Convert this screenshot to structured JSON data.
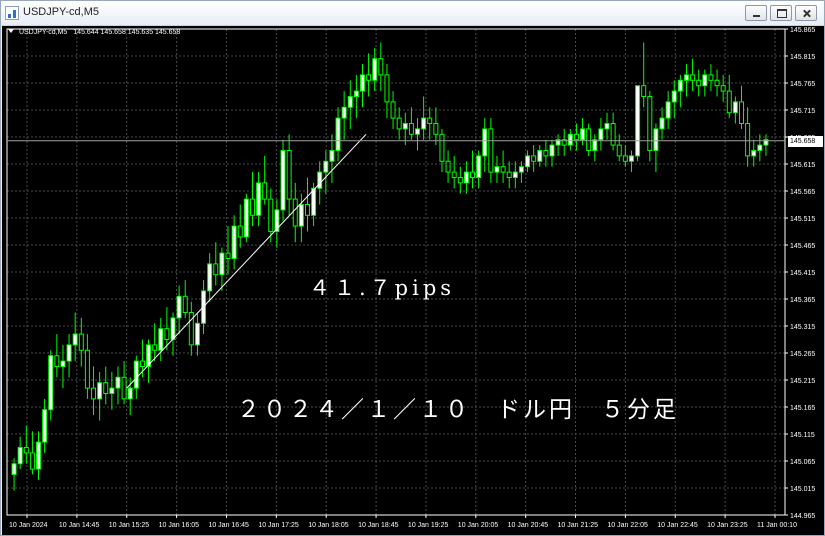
{
  "window": {
    "title": "USDJPY-cd,M5"
  },
  "header": {
    "symbol": "USDJPY-cd,M5",
    "ohlc": "145.644 145.658 145.635 145.658"
  },
  "annotations": {
    "pips": "４１.７pips",
    "title": "２０２４／１／１０　ドル円　５分足"
  },
  "current_price": "145.658",
  "colors": {
    "background": "#000000",
    "grid": "#4a4a4a",
    "candle": "#00ff00",
    "bear_fill": "#000000",
    "bull_fill": "#ffffff",
    "text": "#ffffff",
    "trendline": "#ffffff"
  },
  "chart_data": {
    "type": "candlestick",
    "symbol": "USDJPY-cd",
    "timeframe": "M5",
    "y_ticks": [
      "145.865",
      "145.815",
      "145.765",
      "145.715",
      "145.665",
      "145.615",
      "145.565",
      "145.515",
      "145.465",
      "145.415",
      "145.365",
      "145.315",
      "145.265",
      "145.215",
      "145.165",
      "145.115",
      "145.065",
      "145.015",
      "144.965"
    ],
    "ylim": [
      144.965,
      145.865
    ],
    "x_ticks": [
      "10 Jan 2024",
      "10 Jan 14:45",
      "10 Jan 15:25",
      "10 Jan 16:05",
      "10 Jan 16:45",
      "10 Jan 17:25",
      "10 Jan 18:05",
      "10 Jan 18:45",
      "10 Jan 19:25",
      "10 Jan 20:05",
      "10 Jan 20:45",
      "10 Jan 21:25",
      "10 Jan 22:05",
      "10 Jan 22:45",
      "10 Jan 23:25",
      "11 Jan 00:10"
    ],
    "trendline": {
      "start": {
        "time": "10 Jan 15:25",
        "price": 145.2
      },
      "end": {
        "time": "10 Jan 18:40",
        "price": 145.67
      }
    },
    "candles": [
      [
        145.04,
        145.07,
        145.01,
        145.06
      ],
      [
        145.06,
        145.11,
        145.05,
        145.09
      ],
      [
        145.09,
        145.13,
        145.06,
        145.08
      ],
      [
        145.08,
        145.12,
        145.04,
        145.05
      ],
      [
        145.05,
        145.12,
        145.03,
        145.1
      ],
      [
        145.1,
        145.18,
        145.08,
        145.16
      ],
      [
        145.16,
        145.27,
        145.14,
        145.26
      ],
      [
        145.26,
        145.3,
        145.22,
        145.24
      ],
      [
        145.24,
        145.28,
        145.2,
        145.25
      ],
      [
        145.25,
        145.3,
        145.22,
        145.28
      ],
      [
        145.28,
        145.34,
        145.25,
        145.3
      ],
      [
        145.3,
        145.33,
        145.24,
        145.27
      ],
      [
        145.27,
        145.3,
        145.18,
        145.2
      ],
      [
        145.2,
        145.24,
        145.15,
        145.18
      ],
      [
        145.18,
        145.23,
        145.14,
        145.21
      ],
      [
        145.21,
        145.24,
        145.17,
        145.19
      ],
      [
        145.19,
        145.23,
        145.16,
        145.2
      ],
      [
        145.2,
        145.24,
        145.17,
        145.22
      ],
      [
        145.22,
        145.25,
        145.17,
        145.18
      ],
      [
        145.18,
        145.22,
        145.15,
        145.2
      ],
      [
        145.2,
        145.26,
        145.18,
        145.25
      ],
      [
        145.25,
        145.29,
        145.22,
        145.24
      ],
      [
        145.24,
        145.29,
        145.21,
        145.28
      ],
      [
        145.28,
        145.32,
        145.25,
        145.27
      ],
      [
        145.27,
        145.33,
        145.25,
        145.31
      ],
      [
        145.31,
        145.35,
        145.27,
        145.29
      ],
      [
        145.29,
        145.34,
        145.26,
        145.33
      ],
      [
        145.33,
        145.39,
        145.3,
        145.37
      ],
      [
        145.37,
        145.4,
        145.33,
        145.34
      ],
      [
        145.34,
        145.36,
        145.26,
        145.28
      ],
      [
        145.28,
        145.34,
        145.26,
        145.32
      ],
      [
        145.32,
        145.4,
        145.3,
        145.38
      ],
      [
        145.38,
        145.45,
        145.36,
        145.43
      ],
      [
        145.43,
        145.47,
        145.39,
        145.41
      ],
      [
        145.41,
        145.46,
        145.38,
        145.45
      ],
      [
        145.45,
        145.5,
        145.41,
        145.44
      ],
      [
        145.44,
        145.52,
        145.42,
        145.5
      ],
      [
        145.5,
        145.54,
        145.46,
        145.48
      ],
      [
        145.48,
        145.56,
        145.47,
        145.55
      ],
      [
        145.55,
        145.6,
        145.5,
        145.52
      ],
      [
        145.52,
        145.6,
        145.5,
        145.58
      ],
      [
        145.58,
        145.63,
        145.54,
        145.55
      ],
      [
        145.55,
        145.57,
        145.47,
        145.49
      ],
      [
        145.49,
        145.55,
        145.46,
        145.53
      ],
      [
        145.53,
        145.66,
        145.51,
        145.64
      ],
      [
        145.64,
        145.67,
        145.52,
        145.55
      ],
      [
        145.55,
        145.58,
        145.47,
        145.5
      ],
      [
        145.5,
        145.56,
        145.47,
        145.54
      ],
      [
        145.54,
        145.59,
        145.49,
        145.52
      ],
      [
        145.52,
        145.58,
        145.5,
        145.57
      ],
      [
        145.57,
        145.62,
        145.54,
        145.6
      ],
      [
        145.6,
        145.64,
        145.56,
        145.62
      ],
      [
        145.62,
        145.67,
        145.58,
        145.64
      ],
      [
        145.64,
        145.72,
        145.62,
        145.7
      ],
      [
        145.7,
        145.75,
        145.66,
        145.72
      ],
      [
        145.72,
        145.77,
        145.68,
        145.74
      ],
      [
        145.74,
        145.78,
        145.7,
        145.75
      ],
      [
        145.75,
        145.8,
        145.72,
        145.78
      ],
      [
        145.78,
        145.82,
        145.74,
        145.77
      ],
      [
        145.77,
        145.83,
        145.75,
        145.81
      ],
      [
        145.81,
        145.84,
        145.75,
        145.78
      ],
      [
        145.78,
        145.8,
        145.7,
        145.73
      ],
      [
        145.73,
        145.75,
        145.68,
        145.7
      ],
      [
        145.7,
        145.72,
        145.66,
        145.68
      ],
      [
        145.68,
        145.71,
        145.65,
        145.69
      ],
      [
        145.69,
        145.72,
        145.66,
        145.67
      ],
      [
        145.67,
        145.7,
        145.64,
        145.68
      ],
      [
        145.68,
        145.74,
        145.66,
        145.7
      ],
      [
        145.7,
        145.72,
        145.66,
        145.69
      ],
      [
        145.69,
        145.72,
        145.65,
        145.67
      ],
      [
        145.67,
        145.68,
        145.6,
        145.62
      ],
      [
        145.62,
        145.64,
        145.58,
        145.6
      ],
      [
        145.6,
        145.63,
        145.57,
        145.59
      ],
      [
        145.59,
        145.61,
        145.56,
        145.58
      ],
      [
        145.58,
        145.62,
        145.56,
        145.6
      ],
      [
        145.6,
        145.64,
        145.57,
        145.59
      ],
      [
        145.59,
        145.64,
        145.57,
        145.63
      ],
      [
        145.63,
        145.7,
        145.6,
        145.68
      ],
      [
        145.68,
        145.7,
        145.58,
        145.6
      ],
      [
        145.6,
        145.63,
        145.58,
        145.61
      ],
      [
        145.61,
        145.64,
        145.58,
        145.6
      ],
      [
        145.6,
        145.62,
        145.57,
        145.59
      ],
      [
        145.59,
        145.62,
        145.57,
        145.6
      ],
      [
        145.6,
        145.62,
        145.58,
        145.61
      ],
      [
        145.61,
        145.64,
        145.6,
        145.63
      ],
      [
        145.63,
        145.65,
        145.6,
        145.62
      ],
      [
        145.62,
        145.65,
        145.61,
        145.64
      ],
      [
        145.64,
        145.66,
        145.61,
        145.63
      ],
      [
        145.63,
        145.66,
        145.61,
        145.65
      ],
      [
        145.65,
        145.67,
        145.63,
        145.66
      ],
      [
        145.66,
        145.68,
        145.63,
        145.65
      ],
      [
        145.65,
        145.68,
        145.64,
        145.67
      ],
      [
        145.67,
        145.69,
        145.64,
        145.66
      ],
      [
        145.66,
        145.7,
        145.65,
        145.68
      ],
      [
        145.68,
        145.69,
        145.63,
        145.64
      ],
      [
        145.64,
        145.67,
        145.62,
        145.66
      ],
      [
        145.66,
        145.7,
        145.64,
        145.68
      ],
      [
        145.68,
        145.71,
        145.66,
        145.69
      ],
      [
        145.69,
        145.71,
        145.64,
        145.65
      ],
      [
        145.65,
        145.67,
        145.62,
        145.63
      ],
      [
        145.63,
        145.65,
        145.61,
        145.62
      ],
      [
        145.62,
        145.64,
        145.6,
        145.63
      ],
      [
        145.63,
        145.68,
        145.62,
        145.76
      ],
      [
        145.76,
        145.84,
        145.72,
        145.74
      ],
      [
        145.74,
        145.75,
        145.62,
        145.64
      ],
      [
        145.64,
        145.69,
        145.6,
        145.68
      ],
      [
        145.68,
        145.72,
        145.66,
        145.7
      ],
      [
        145.7,
        145.75,
        145.68,
        145.73
      ],
      [
        145.73,
        145.77,
        145.7,
        145.75
      ],
      [
        145.75,
        145.78,
        145.72,
        145.77
      ],
      [
        145.77,
        145.8,
        145.74,
        145.78
      ],
      [
        145.78,
        145.81,
        145.75,
        145.77
      ],
      [
        145.77,
        145.79,
        145.74,
        145.76
      ],
      [
        145.76,
        145.79,
        145.74,
        145.78
      ],
      [
        145.78,
        145.8,
        145.75,
        145.77
      ],
      [
        145.77,
        145.79,
        145.74,
        145.76
      ],
      [
        145.76,
        145.78,
        145.73,
        145.75
      ],
      [
        145.75,
        145.78,
        145.7,
        145.71
      ],
      [
        145.71,
        145.74,
        145.69,
        145.73
      ],
      [
        145.73,
        145.76,
        145.68,
        145.69
      ],
      [
        145.69,
        145.72,
        145.61,
        145.63
      ],
      [
        145.63,
        145.66,
        145.61,
        145.64
      ],
      [
        145.64,
        145.67,
        145.62,
        145.65
      ],
      [
        145.65,
        145.67,
        145.63,
        145.66
      ]
    ]
  }
}
